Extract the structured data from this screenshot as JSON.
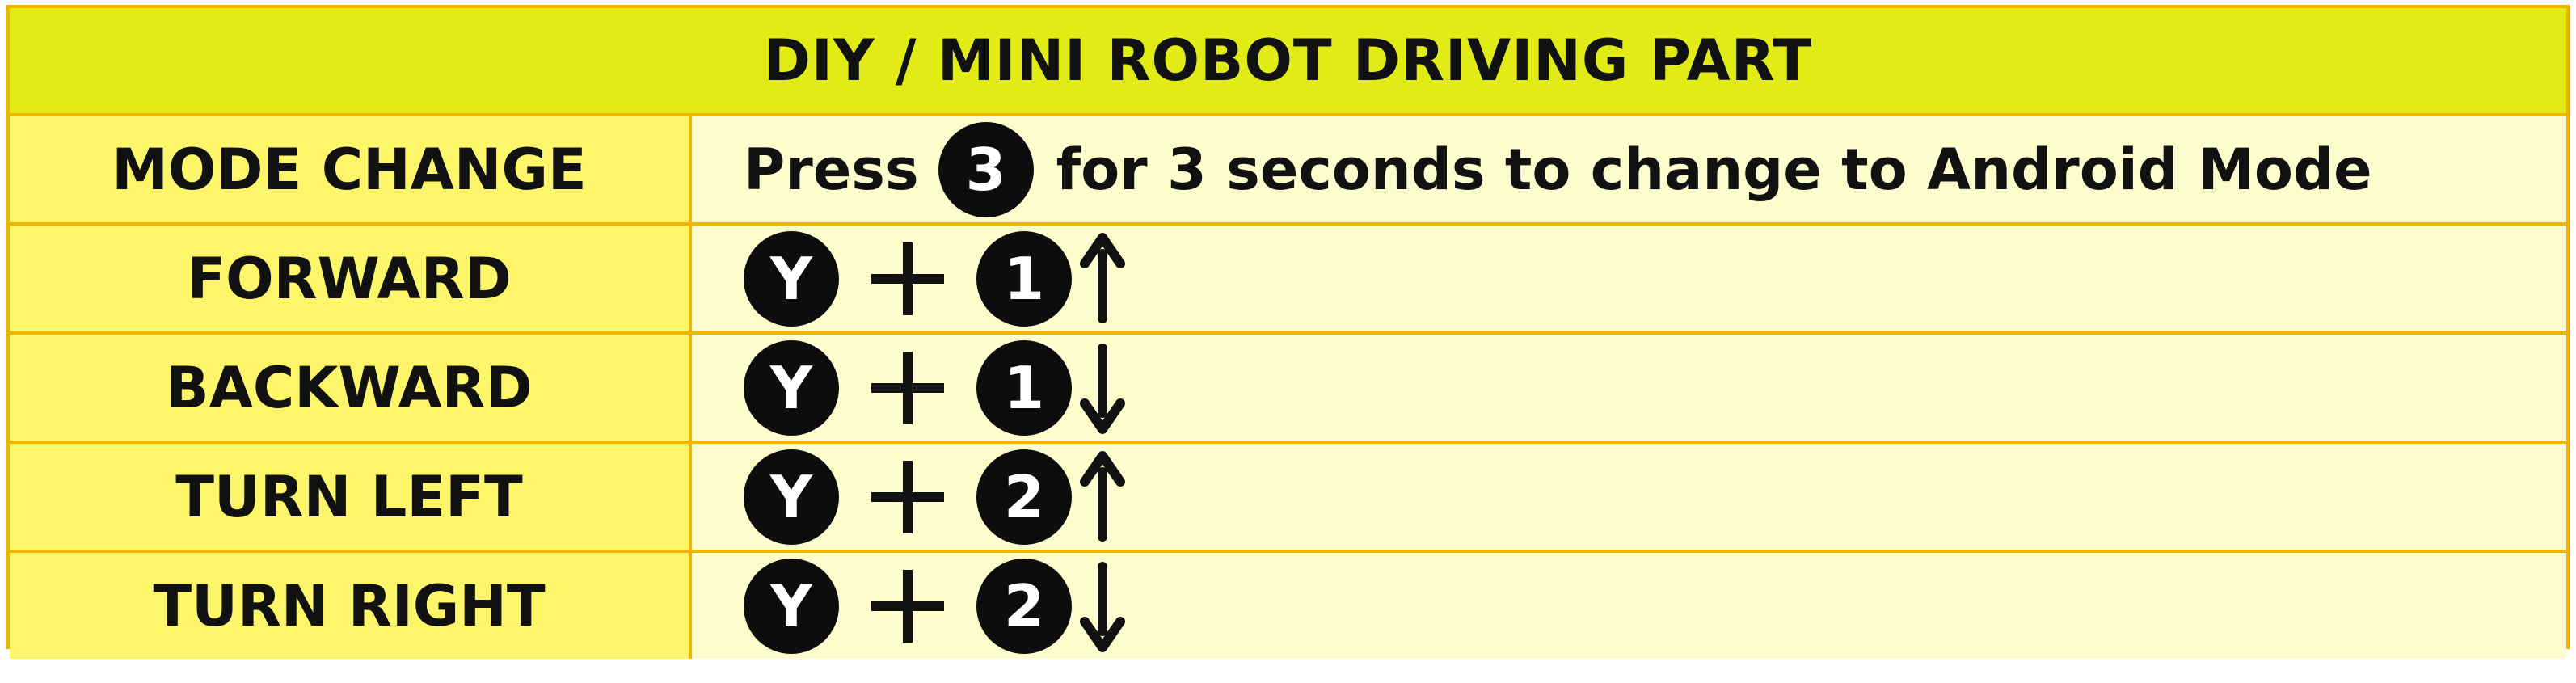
{
  "title": "DIY / MINI ROBOT DRIVING PART",
  "mode_change": {
    "label": "MODE CHANGE",
    "prefix": "Press",
    "button": "3",
    "suffix": "for 3 seconds to change to Android Mode"
  },
  "rows": [
    {
      "label": "FORWARD",
      "key1": "Y",
      "key2": "1",
      "direction": "up-arrow"
    },
    {
      "label": "BACKWARD",
      "key1": "Y",
      "key2": "1",
      "direction": "down-arrow"
    },
    {
      "label": "TURN LEFT",
      "key1": "Y",
      "key2": "2",
      "direction": "up-arrow"
    },
    {
      "label": "TURN RIGHT",
      "key1": "Y",
      "key2": "2",
      "direction": "down-arrow"
    }
  ],
  "colors": {
    "header": "#e1ec16",
    "label_cell": "#fdf66b",
    "value_cell": "#fcfccc",
    "border": "#f0b400",
    "badge": "#0d0d0d"
  }
}
